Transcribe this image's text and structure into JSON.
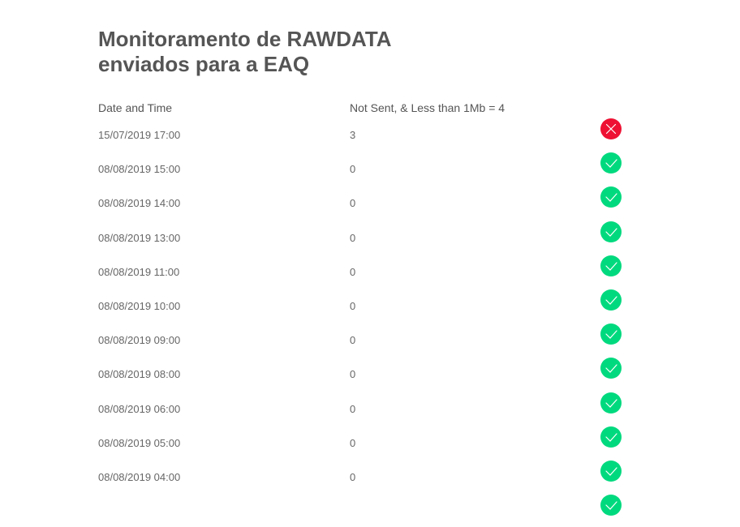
{
  "page": {
    "title_line1": "Monitoramento de RAWDATA",
    "title_line2": "enviados para a EAQ"
  },
  "table": {
    "headers": {
      "date": "Date and Time",
      "count": "Not Sent, & Less than 1Mb = 4"
    },
    "rows": [
      {
        "date": "15/07/2019 17:00",
        "count": "3",
        "status": "error-icon"
      },
      {
        "date": "08/08/2019 15:00",
        "count": "0",
        "status": "check-icon"
      },
      {
        "date": "08/08/2019 14:00",
        "count": "0",
        "status": "check-icon"
      },
      {
        "date": "08/08/2019 13:00",
        "count": "0",
        "status": "check-icon"
      },
      {
        "date": "08/08/2019 11:00",
        "count": "0",
        "status": "check-icon"
      },
      {
        "date": "08/08/2019 10:00",
        "count": "0",
        "status": "check-icon"
      },
      {
        "date": "08/08/2019 09:00",
        "count": "0",
        "status": "check-icon"
      },
      {
        "date": "08/08/2019 08:00",
        "count": "0",
        "status": "check-icon"
      },
      {
        "date": "08/08/2019 06:00",
        "count": "0",
        "status": "check-icon"
      },
      {
        "date": "08/08/2019 05:00",
        "count": "0",
        "status": "check-icon"
      },
      {
        "date": "08/08/2019 04:00",
        "count": "0",
        "status": "check-icon"
      },
      {
        "date": "",
        "count": "",
        "status": "check-icon"
      }
    ]
  },
  "colors": {
    "ok": "#00d97e",
    "error": "#ee1133"
  }
}
